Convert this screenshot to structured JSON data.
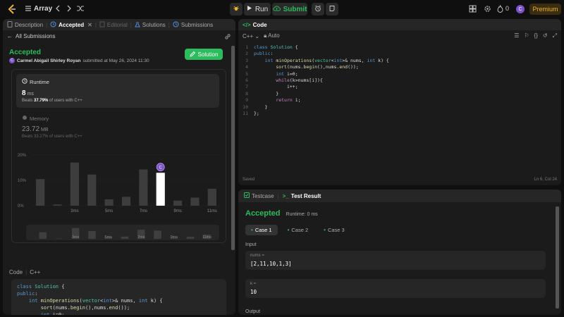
{
  "topbar": {
    "problem_title": "Array",
    "run_label": "Run",
    "submit_label": "Submit",
    "streak_count": "0",
    "avatar_initial": "C",
    "premium_label": "Premium"
  },
  "left_tabs": [
    {
      "label": "Description"
    },
    {
      "label": "Accepted"
    },
    {
      "label": "Editorial"
    },
    {
      "label": "Solutions"
    },
    {
      "label": "Submissions"
    }
  ],
  "submission": {
    "back_label": "All Submissions",
    "status": "Accepted",
    "avatar_initial": "C",
    "submitter": "Carmel Abigail Shirley Royan",
    "submitted_text": "submitted at May 26, 2024 11:30",
    "solution_button": "Solution",
    "runtime_label": "Runtime",
    "runtime_value": "8",
    "runtime_unit": "ms",
    "runtime_beats_prefix": "Beats",
    "runtime_beats_pct": "37.79%",
    "runtime_beats_suffix": "of users with C++",
    "memory_label": "Memory",
    "memory_value": "23.72",
    "memory_unit": "MB",
    "memory_beats": "Beats 33.27% of users with C++",
    "code_section_label": "Code",
    "code_section_lang": "C++"
  },
  "chart_data": {
    "type": "bar",
    "title": "",
    "xlabel": "",
    "ylabel": "",
    "ylim": [
      0,
      20
    ],
    "y_ticks": [
      "0%",
      "10%",
      "20%"
    ],
    "x_tick_labels": [
      "3ms",
      "5ms",
      "7ms",
      "9ms",
      "11ms"
    ],
    "values": [
      10.5,
      0.5,
      17,
      12.3,
      2.5,
      3.5,
      14.3,
      13,
      2,
      3.2,
      6.7
    ],
    "highlight_index": 7,
    "highlight_marker": "C",
    "brush_values": [
      10.5,
      0.5,
      17,
      12.3,
      2.5,
      3.5,
      14.3,
      13,
      2,
      3.2,
      6.7
    ],
    "brush_tick_labels": [
      "3ms",
      "5ms",
      "7ms",
      "9ms",
      "11ms"
    ],
    "colors": {
      "bar": "#3d3d3d",
      "highlight": "#ffffff",
      "marker": "#7b52c9"
    }
  },
  "code_panel": {
    "title": "Code",
    "language": "C++",
    "mode": "Auto",
    "saved_label": "Saved",
    "cursor_position": "Ln 6, Col 24",
    "lines": [
      "class Solution {",
      "public:",
      "    int minOperations(vector<int>& nums, int k) {",
      "        sort(nums.begin(),nums.end());",
      "        int i=0;",
      "        while(k>nums[i]){",
      "            i++;",
      "        }",
      "        return i;",
      "    }",
      "};"
    ]
  },
  "code_preview_lines": [
    "class Solution {",
    "public:",
    "    int minOperations(vector<int>& nums, int k) {",
    "        sort(nums.begin(),nums.end());",
    "        int i=0;",
    "        while(k>nums[i]){",
    "            i++;"
  ],
  "test_panel": {
    "testcase_tab": "Testcase",
    "result_tab": "Test Result",
    "status": "Accepted",
    "runtime": "Runtime: 0 ms",
    "cases": [
      "Case 1",
      "Case 2",
      "Case 3"
    ],
    "input_label": "Input",
    "inputs": [
      {
        "name": "nums =",
        "value": "[2,11,10,1,3]"
      },
      {
        "name": "k =",
        "value": "10"
      }
    ],
    "output_label": "Output"
  },
  "colors": {
    "accent_green": "#2cbb5d",
    "premium_gold": "#f0b429",
    "avatar_purple": "#7b52c9"
  }
}
